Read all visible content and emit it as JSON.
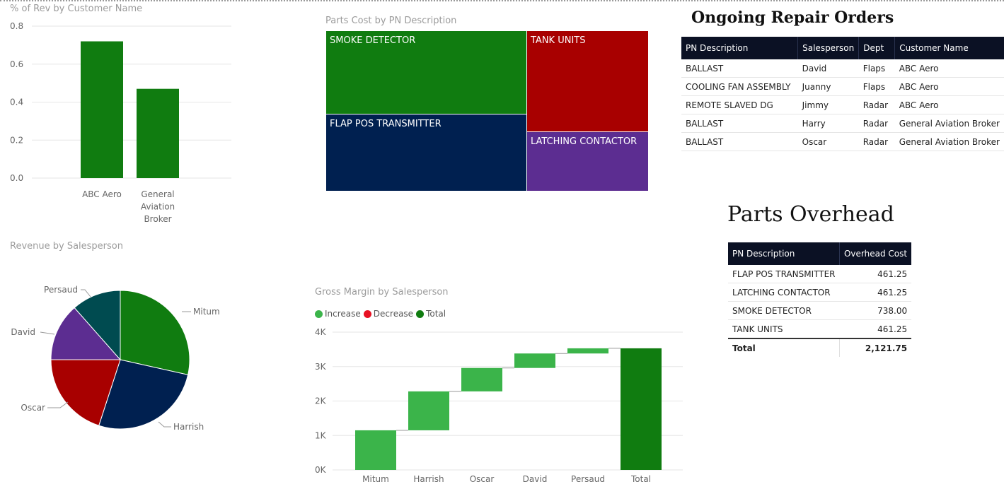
{
  "colors": {
    "green": "#107c10",
    "navy": "#002050",
    "red": "#a80000",
    "purple": "#5c2d91",
    "teal": "#004b50",
    "increase": "#3bb44a",
    "decrease": "#e81123",
    "total": "#107c10",
    "header_bg": "#0b1124"
  },
  "rev_chart": {
    "title": "% of Rev by Customer Name",
    "chart_data": {
      "type": "bar",
      "categories": [
        "ABC Aero",
        "General Aviation Broker"
      ],
      "category_lines": [
        [
          "ABC Aero"
        ],
        [
          "General",
          "Aviation",
          "Broker"
        ]
      ],
      "values": [
        0.72,
        0.47
      ],
      "ylim": [
        0,
        0.8
      ],
      "yticks": [
        "0.0",
        "0.2",
        "0.4",
        "0.6",
        "0.8"
      ],
      "ytick_values": [
        0,
        0.2,
        0.4,
        0.6,
        0.8
      ],
      "grid": true
    }
  },
  "treemap": {
    "title": "Parts Cost by PN Description",
    "chart_data": {
      "type": "treemap",
      "items": [
        {
          "label": "SMOKE DETECTOR",
          "value": 738.0
        },
        {
          "label": "FLAP POS TRANSMITTER",
          "value": 461.25
        },
        {
          "label": "TANK UNITS",
          "value": 461.25
        },
        {
          "label": "LATCHING CONTACTOR",
          "value": 461.25
        }
      ]
    }
  },
  "repair_orders": {
    "title": "Ongoing Repair Orders",
    "columns": [
      "PN Description",
      "Salesperson",
      "Dept",
      "Customer Name"
    ],
    "rows": [
      [
        "BALLAST",
        "David",
        "Flaps",
        "ABC Aero"
      ],
      [
        "COOLING FAN ASSEMBLY",
        "Juanny",
        "Flaps",
        "ABC Aero"
      ],
      [
        "REMOTE SLAVED DG",
        "Jimmy",
        "Radar",
        "ABC Aero"
      ],
      [
        "BALLAST",
        "Harry",
        "Radar",
        "General Aviation Broker"
      ],
      [
        "BALLAST",
        "Oscar",
        "Radar",
        "General Aviation Broker"
      ]
    ]
  },
  "overhead": {
    "title": "Parts Overhead",
    "columns": [
      "PN Description",
      "Overhead Cost"
    ],
    "rows": [
      [
        "FLAP POS TRANSMITTER",
        "461.25"
      ],
      [
        "LATCHING CONTACTOR",
        "461.25"
      ],
      [
        "SMOKE DETECTOR",
        "738.00"
      ],
      [
        "TANK UNITS",
        "461.25"
      ]
    ],
    "total_label": "Total",
    "total_value": "2,121.75"
  },
  "pie": {
    "title": "Revenue by Salesperson",
    "chart_data": {
      "type": "pie",
      "slices": [
        {
          "label": "Mitum",
          "value": 28.5,
          "color": "#107c10"
        },
        {
          "label": "Harrish",
          "value": 26.5,
          "color": "#002050"
        },
        {
          "label": "Oscar",
          "value": 20.0,
          "color": "#a80000"
        },
        {
          "label": "David",
          "value": 13.5,
          "color": "#5c2d91"
        },
        {
          "label": "Persaud",
          "value": 11.5,
          "color": "#004b50"
        }
      ]
    }
  },
  "waterfall": {
    "title": "Gross Margin by Salesperson",
    "legend": [
      "Increase",
      "Decrease",
      "Total"
    ],
    "chart_data": {
      "type": "waterfall",
      "categories": [
        "Mitum",
        "Harrish",
        "Oscar",
        "David",
        "Persaud",
        "Total"
      ],
      "values": [
        1150,
        1130,
        680,
        420,
        150,
        3530
      ],
      "kinds": [
        "increase",
        "increase",
        "increase",
        "increase",
        "increase",
        "total"
      ],
      "ylim": [
        0,
        4000
      ],
      "yticks": [
        "0K",
        "1K",
        "2K",
        "3K",
        "4K"
      ],
      "ytick_values": [
        0,
        1000,
        2000,
        3000,
        4000
      ],
      "grid": true
    }
  }
}
